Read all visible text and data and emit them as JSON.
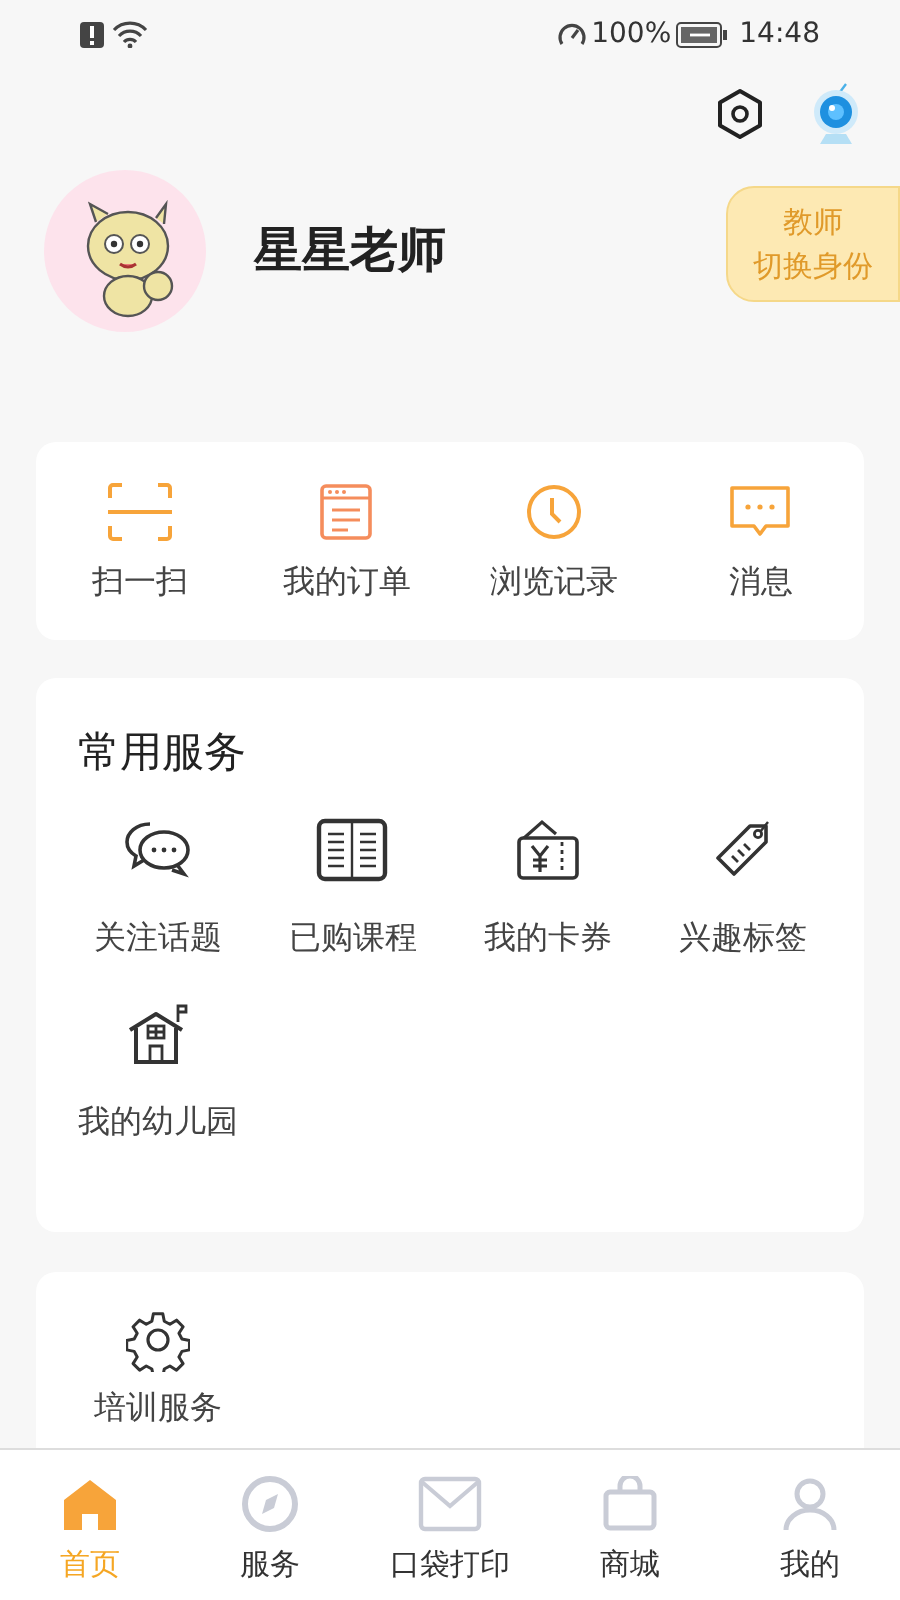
{
  "status_bar": {
    "battery": "100%",
    "time": "14:48"
  },
  "profile": {
    "name": "星星老师",
    "role": "教师",
    "switch_label": "切换身份"
  },
  "quick_actions": [
    {
      "label": "扫一扫"
    },
    {
      "label": "我的订单"
    },
    {
      "label": "浏览记录"
    },
    {
      "label": "消息"
    }
  ],
  "common_services": {
    "title": "常用服务",
    "items": [
      {
        "label": "关注话题"
      },
      {
        "label": "已购课程"
      },
      {
        "label": "我的卡券"
      },
      {
        "label": "兴趣标签"
      },
      {
        "label": "我的幼儿园"
      }
    ]
  },
  "training": {
    "items": [
      {
        "label": "培训服务"
      }
    ]
  },
  "tab_bar": [
    {
      "label": "首页",
      "selected": true
    },
    {
      "label": "服务",
      "selected": false
    },
    {
      "label": "口袋打印",
      "selected": false
    },
    {
      "label": "商城",
      "selected": false
    },
    {
      "label": "我的",
      "selected": false
    }
  ]
}
